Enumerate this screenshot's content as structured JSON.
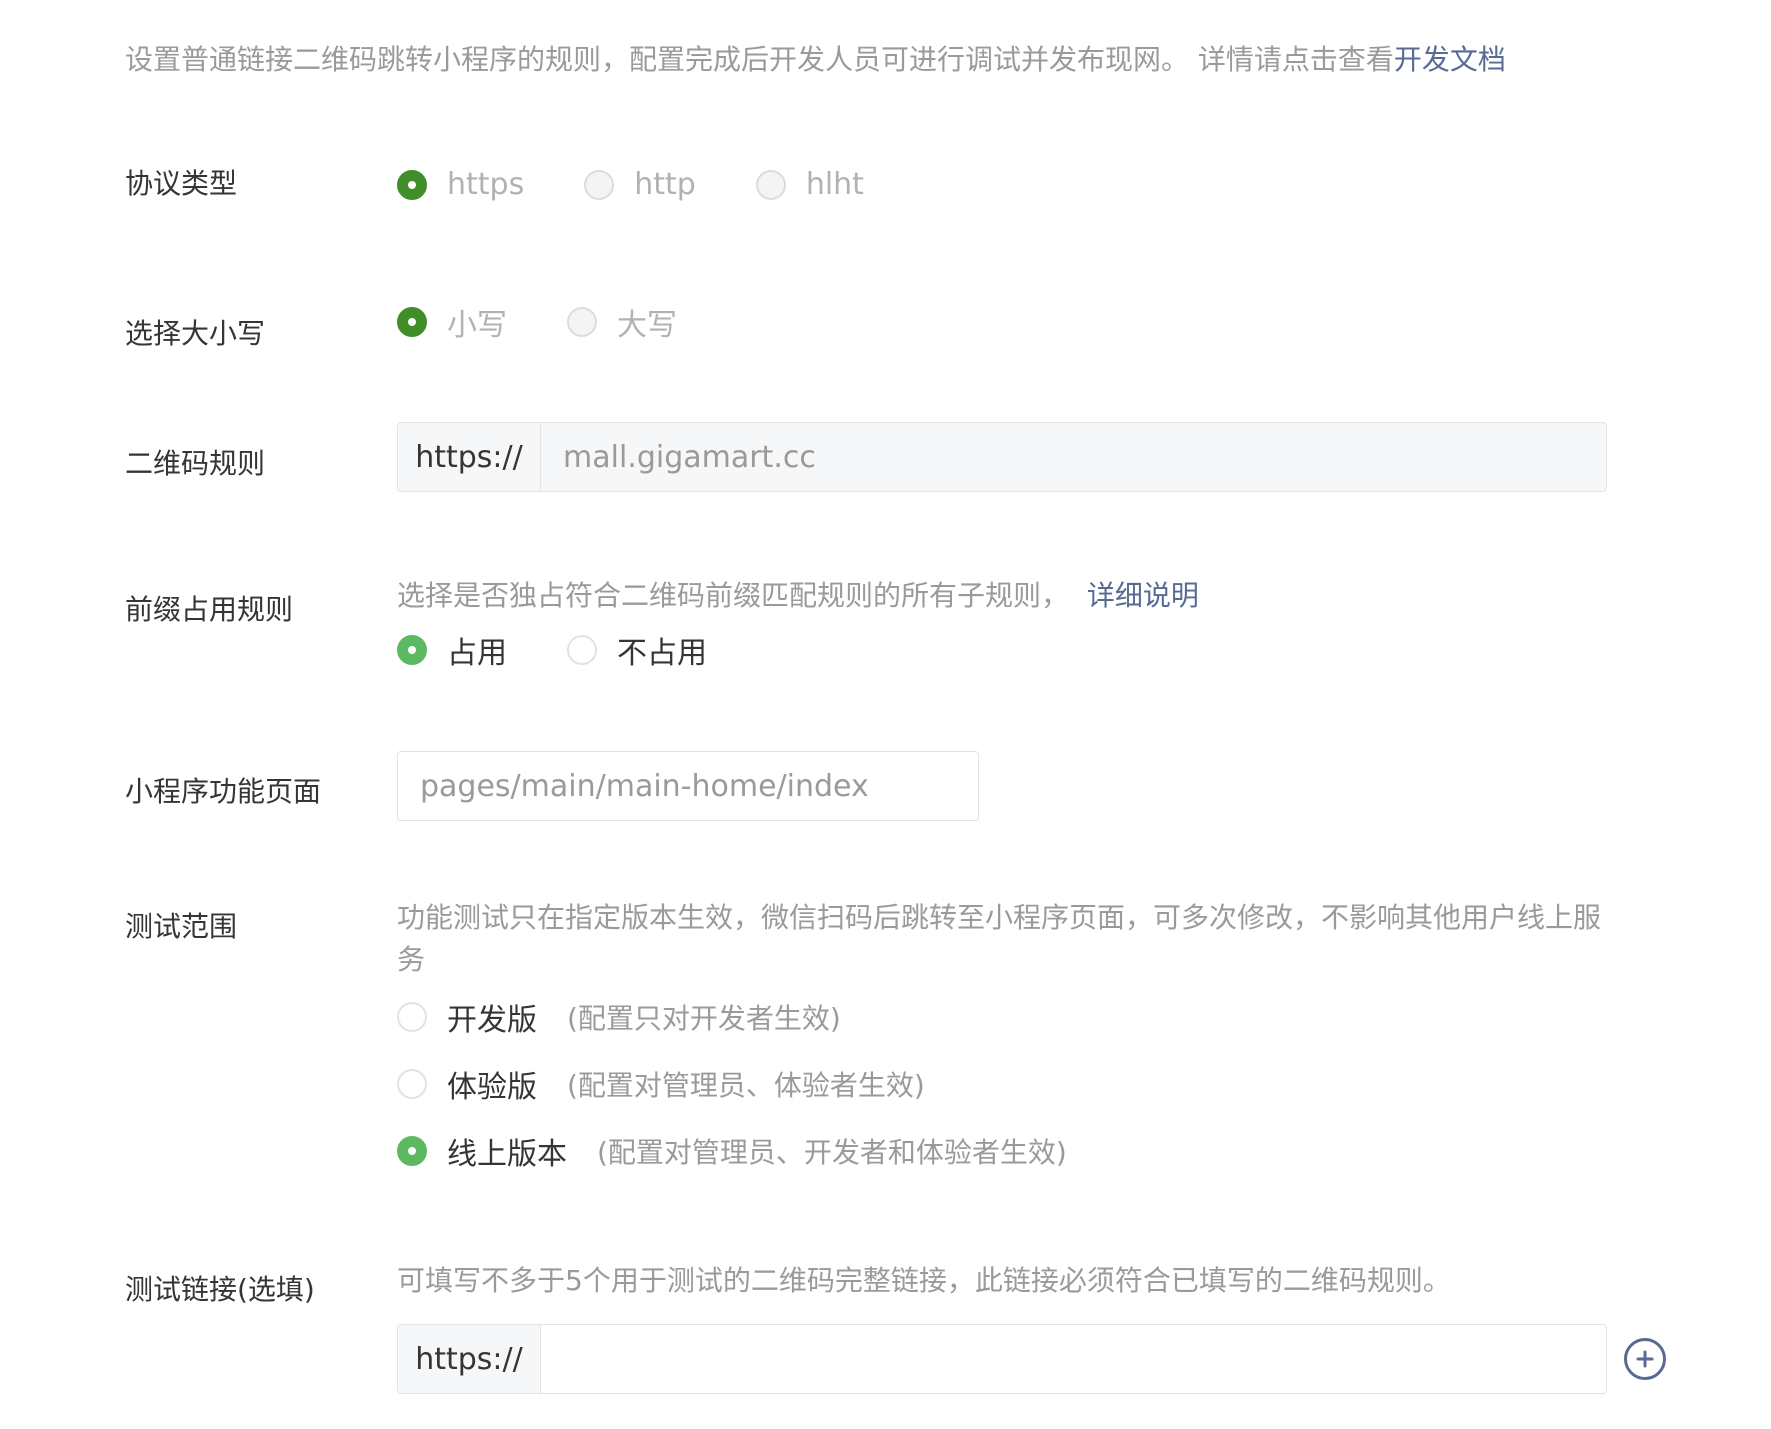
{
  "intro": {
    "text": "设置普通链接二维码跳转小程序的规则，配置完成后开发人员可进行调试并发布现网。 详情请点击查看",
    "link": "开发文档"
  },
  "protocol": {
    "label": "协议类型",
    "options": [
      "https",
      "http",
      "hlht"
    ],
    "selected": "https"
  },
  "case": {
    "label": "选择大小写",
    "options": [
      "小写",
      "大写"
    ],
    "selected": "小写"
  },
  "qr_rule": {
    "label": "二维码规则",
    "prefix": "https://",
    "placeholder": "mall.gigamart.cc"
  },
  "prefix_rule": {
    "label": "前缀占用规则",
    "desc": "选择是否独占符合二维码前缀匹配规则的所有子规则，",
    "link": "详细说明",
    "options": [
      "占用",
      "不占用"
    ],
    "selected": "占用"
  },
  "page": {
    "label": "小程序功能页面",
    "placeholder": "pages/main/main-home/index"
  },
  "test_scope": {
    "label": "测试范围",
    "desc_line1": "功能测试只在指定版本生效，微信扫码后跳转至小程序页面，可多次修改，不影响其他用户线上服",
    "desc_line2": "务",
    "options": [
      {
        "label": "开发版",
        "note": "(配置只对开发者生效)"
      },
      {
        "label": "体验版",
        "note": "(配置对管理员、体验者生效)"
      },
      {
        "label": "线上版本",
        "note": "(配置对管理员、开发者和体验者生效)"
      }
    ],
    "selected": "线上版本"
  },
  "test_link": {
    "label": "测试链接(选填)",
    "desc": "可填写不多于5个用于测试的二维码完整链接，此链接必须符合已填写的二维码规则。",
    "prefix": "https://",
    "value": ""
  },
  "colors": {
    "link": "#576b95",
    "radio_checked": "#3f8e2a",
    "radio_checked_bright": "#5cb962"
  }
}
